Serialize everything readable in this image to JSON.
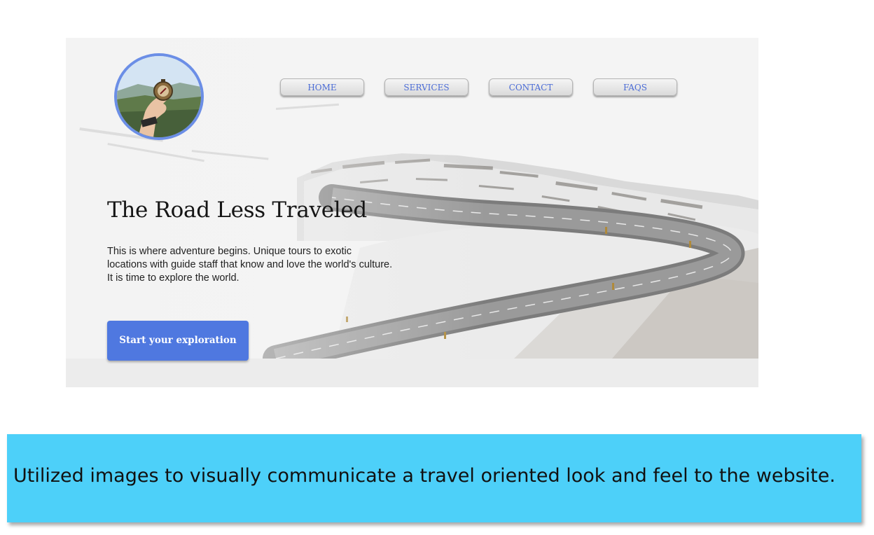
{
  "hero": {
    "nav": [
      {
        "label": "HOME"
      },
      {
        "label": "SERVICES"
      },
      {
        "label": "CONTACT"
      },
      {
        "label": "FAQS"
      }
    ],
    "title": "The Road Less Traveled",
    "body": "This is where adventure begins. Unique tours to exotic locations with guide staff that know and love the world's culture. It is time to explore the world.",
    "cta_label": "Start your exploration"
  },
  "caption": {
    "text": "Utilized images to visually communicate a travel oriented look and feel to the website."
  },
  "colors": {
    "accent": "#4f78e0",
    "nav_text": "#4a6bd6",
    "caption_bg": "#4dd0f9",
    "logo_ring": "#6b8ee6"
  },
  "icons": {
    "logo": "hand-holding-compass-photo"
  }
}
